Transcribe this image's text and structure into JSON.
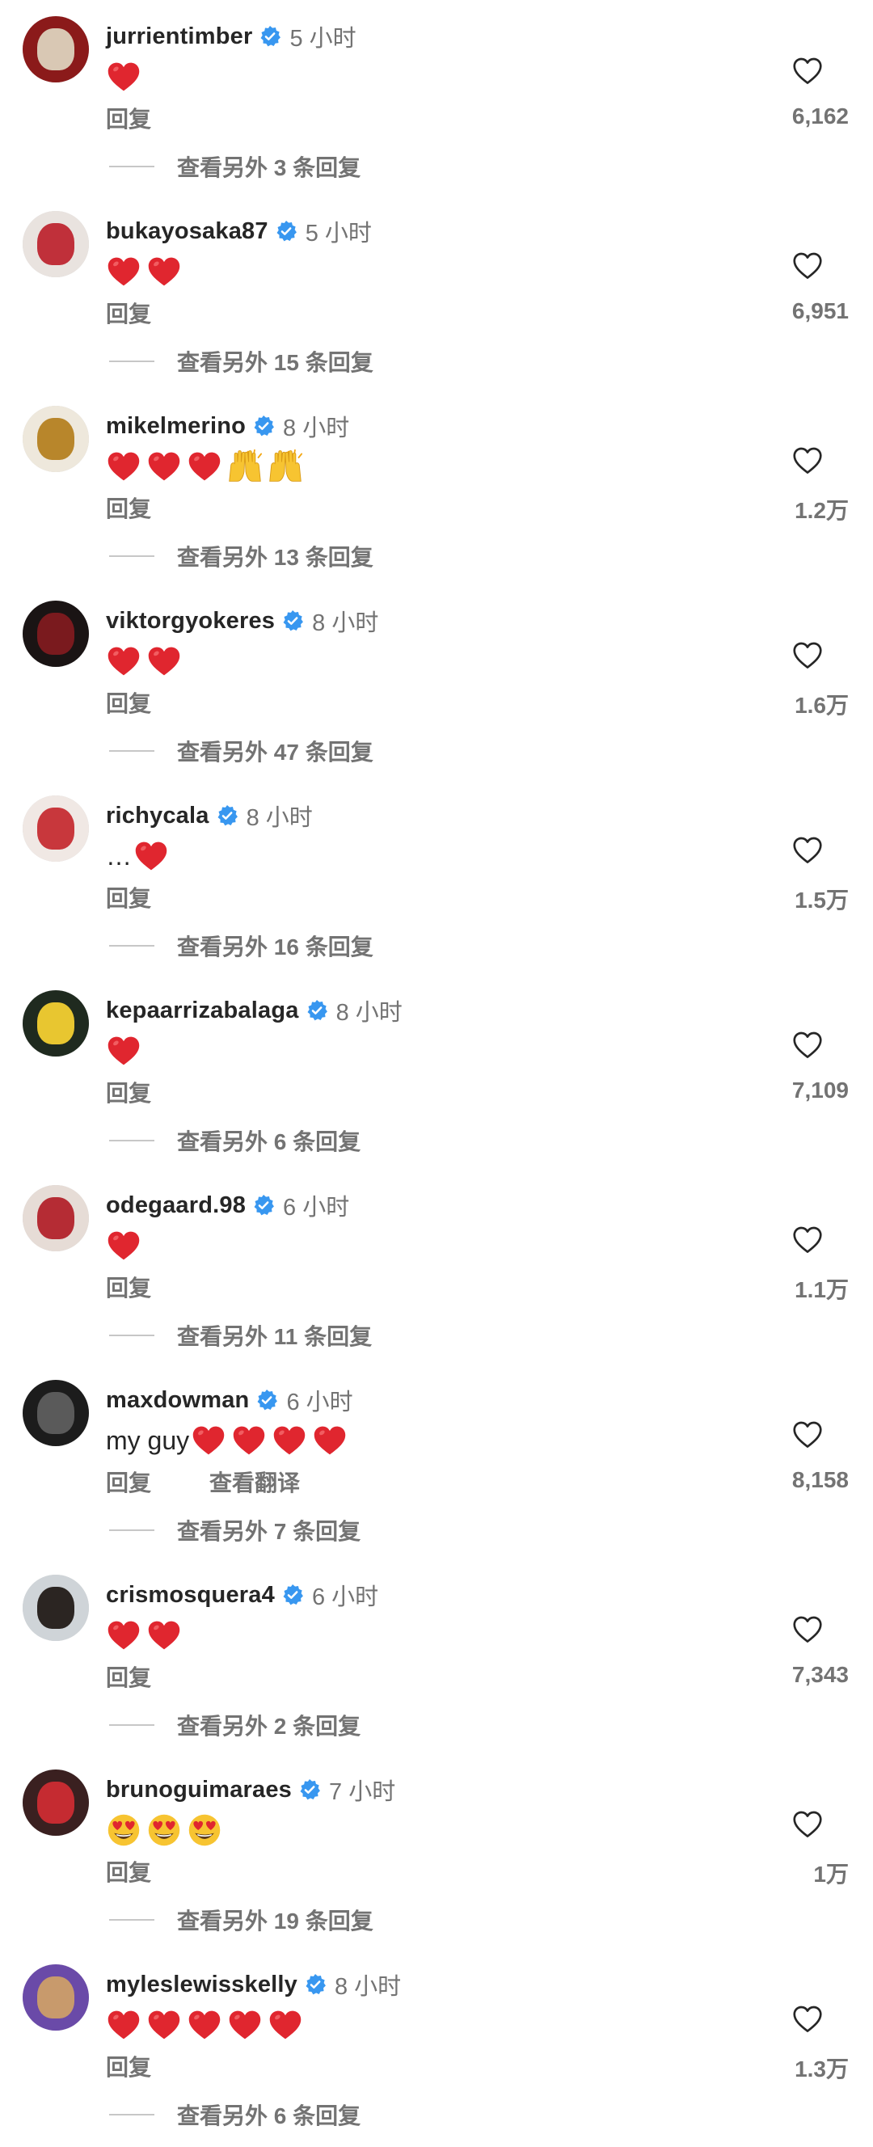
{
  "colors": {
    "verified": "#3897f0",
    "secondary_text": "#737373",
    "primary_text": "#262626",
    "heart_emoji": "#e0262f"
  },
  "comments": [
    {
      "username": "jurrientimber",
      "verified": true,
      "time": "5 小时",
      "text": "",
      "emojis": [
        "red-heart"
      ],
      "reply_label": "回复",
      "translate_label": null,
      "view_replies": "查看另外 3 条回复",
      "likes": "6,162",
      "avatar_colors": [
        "#8b1a1a",
        "#d9c8b4"
      ]
    },
    {
      "username": "bukayosaka87",
      "verified": true,
      "time": "5 小时",
      "text": "",
      "emojis": [
        "red-heart",
        "red-heart"
      ],
      "reply_label": "回复",
      "translate_label": null,
      "view_replies": "查看另外 15 条回复",
      "likes": "6,951",
      "avatar_colors": [
        "#e9e3df",
        "#c0303a"
      ]
    },
    {
      "username": "mikelmerino",
      "verified": true,
      "time": "8 小时",
      "text": "",
      "emojis": [
        "red-heart",
        "red-heart",
        "red-heart",
        "raising-hands",
        "raising-hands"
      ],
      "reply_label": "回复",
      "translate_label": null,
      "view_replies": "查看另外 13 条回复",
      "likes": "1.2万",
      "avatar_colors": [
        "#eee8dc",
        "#b8862b"
      ]
    },
    {
      "username": "viktorgyokeres",
      "verified": true,
      "time": "8 小时",
      "text": "",
      "emojis": [
        "red-heart",
        "red-heart"
      ],
      "reply_label": "回复",
      "translate_label": null,
      "view_replies": "查看另外 47 条回复",
      "likes": "1.6万",
      "avatar_colors": [
        "#1a1414",
        "#7a1a1e"
      ]
    },
    {
      "username": "richycala",
      "verified": true,
      "time": "8 小时",
      "text": "…",
      "emojis": [
        "red-heart"
      ],
      "reply_label": "回复",
      "translate_label": null,
      "view_replies": "查看另外 16 条回复",
      "likes": "1.5万",
      "avatar_colors": [
        "#f0e8e4",
        "#c8373c"
      ]
    },
    {
      "username": "kepaarrizabalaga",
      "verified": true,
      "time": "8 小时",
      "text": "",
      "emojis": [
        "red-heart"
      ],
      "reply_label": "回复",
      "translate_label": null,
      "view_replies": "查看另外 6 条回复",
      "likes": "7,109",
      "avatar_colors": [
        "#1f2a1f",
        "#e8c630"
      ]
    },
    {
      "username": "odegaard.98",
      "verified": true,
      "time": "6 小时",
      "text": "",
      "emojis": [
        "red-heart"
      ],
      "reply_label": "回复",
      "translate_label": null,
      "view_replies": "查看另外 11 条回复",
      "likes": "1.1万",
      "avatar_colors": [
        "#e6dcd6",
        "#b52c34"
      ]
    },
    {
      "username": "maxdowman",
      "verified": true,
      "time": "6 小时",
      "text": "my guy",
      "emojis": [
        "red-heart",
        "red-heart",
        "red-heart",
        "red-heart"
      ],
      "reply_label": "回复",
      "translate_label": "查看翻译",
      "view_replies": "查看另外 7 条回复",
      "likes": "8,158",
      "avatar_colors": [
        "#1c1c1c",
        "#5a5a5a"
      ]
    },
    {
      "username": "crismosquera4",
      "verified": true,
      "time": "6 小时",
      "text": "",
      "emojis": [
        "red-heart",
        "red-heart"
      ],
      "reply_label": "回复",
      "translate_label": null,
      "view_replies": "查看另外 2 条回复",
      "likes": "7,343",
      "avatar_colors": [
        "#cfd4d8",
        "#2b2522"
      ]
    },
    {
      "username": "brunoguimaraes",
      "verified": true,
      "time": "7 小时",
      "text": "",
      "emojis": [
        "smiling-face-heart-eyes",
        "smiling-face-heart-eyes",
        "smiling-face-heart-eyes"
      ],
      "reply_label": "回复",
      "translate_label": null,
      "view_replies": "查看另外 19 条回复",
      "likes": "1万",
      "avatar_colors": [
        "#3a2020",
        "#c52b31"
      ]
    },
    {
      "username": "myleslewisskelly",
      "verified": true,
      "time": "8 小时",
      "text": "",
      "emojis": [
        "red-heart",
        "red-heart",
        "red-heart",
        "red-heart",
        "red-heart"
      ],
      "reply_label": "回复",
      "translate_label": null,
      "view_replies": "查看另外 6 条回复",
      "likes": "1.3万",
      "avatar_colors": [
        "#6a4aa8",
        "#c89a6c"
      ]
    }
  ]
}
